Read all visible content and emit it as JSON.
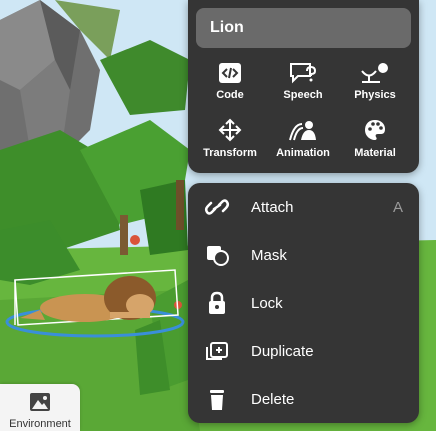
{
  "object_name": "Lion",
  "tools": [
    {
      "label": "Code",
      "icon": "code-icon"
    },
    {
      "label": "Speech",
      "icon": "speech-bubble-icon"
    },
    {
      "label": "Physics",
      "icon": "physics-icon"
    },
    {
      "label": "Transform",
      "icon": "move-arrows-icon"
    },
    {
      "label": "Animation",
      "icon": "animation-icon"
    },
    {
      "label": "Material",
      "icon": "palette-icon"
    }
  ],
  "menu": [
    {
      "label": "Attach",
      "icon": "link-icon",
      "shortcut": "A"
    },
    {
      "label": "Mask",
      "icon": "mask-icon"
    },
    {
      "label": "Lock",
      "icon": "lock-icon"
    },
    {
      "label": "Duplicate",
      "icon": "duplicate-icon"
    },
    {
      "label": "Delete",
      "icon": "trash-icon"
    }
  ],
  "environment_tab": {
    "label": "Environment",
    "icon": "landscape-icon"
  },
  "colors": {
    "panel": "#353535",
    "title_box": "#6a6a6a",
    "ground": "#62b33b",
    "selection": "#3a8fd9"
  }
}
